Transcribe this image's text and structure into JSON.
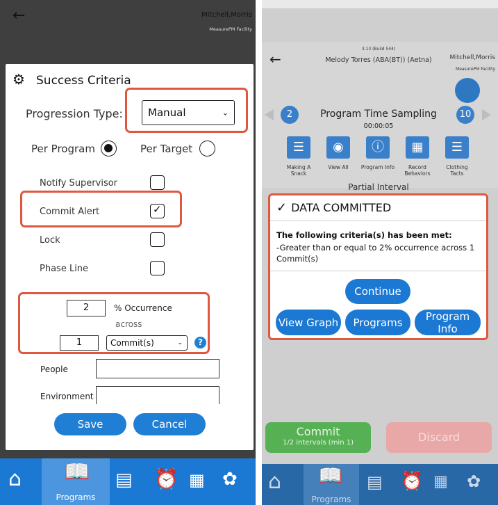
{
  "left": {
    "header": {
      "user": "Mitchell,Morris",
      "facility": "MeasurePM Facility"
    },
    "dialog": {
      "title": "Success Criteria",
      "progression_type_label": "Progression Type:",
      "progression_type_value": "Manual",
      "per_program_label": "Per Program",
      "per_target_label": "Per Target",
      "options": [
        {
          "label": "Notify Supervisor",
          "checked": false
        },
        {
          "label": "Commit Alert",
          "checked": true
        },
        {
          "label": "Lock",
          "checked": false
        },
        {
          "label": "Phase Line",
          "checked": false
        }
      ],
      "occurrence_value": "2",
      "occurrence_label": "% Occurrence",
      "across_label": "across",
      "commit_count": "1",
      "commit_unit": "Commit(s)",
      "help": "?",
      "people_label": "People",
      "environment_label": "Environment",
      "save_label": "Save",
      "cancel_label": "Cancel"
    },
    "nav": {
      "programs_label": "Programs"
    }
  },
  "right": {
    "version": "3.13 (Build 544)",
    "client": "Melody Torres (ABA(BT)) (Aetna)",
    "user": "Mitchell,Morris",
    "facility": "MeasurePM Facility",
    "prev_count": "2",
    "next_count": "10",
    "program_title": "Program Time Sampling",
    "timer": "00:00:05",
    "tiles": [
      {
        "label": "Making A Snack",
        "icon": "book-icon"
      },
      {
        "label": "View All",
        "icon": "eye-icon"
      },
      {
        "label": "Program Info",
        "icon": "info-icon"
      },
      {
        "label": "Record Behaviors",
        "icon": "calendar-icon"
      },
      {
        "label": "Clothing Tacts",
        "icon": "book-icon"
      }
    ],
    "partial_interval": "Partial Interval",
    "modal": {
      "title": "DATA COMMITTED",
      "bold_line": "The following criteria(s) has been met:",
      "detail": "-Greater than or equal to  2% occurrence across 1 Commit(s)",
      "continue_label": "Continue",
      "view_graph_label": "View Graph",
      "programs_label": "Programs",
      "program_info_label": "Program Info"
    },
    "commit_label": "Commit",
    "commit_sub": "1/2 intervals (min 1)",
    "discard_label": "Discard",
    "nav": {
      "programs_label": "Programs"
    }
  },
  "colors": {
    "accent": "#1f7fd5",
    "highlight": "#de5840",
    "commit": "#56b054",
    "discard": "#e9a8a8"
  }
}
